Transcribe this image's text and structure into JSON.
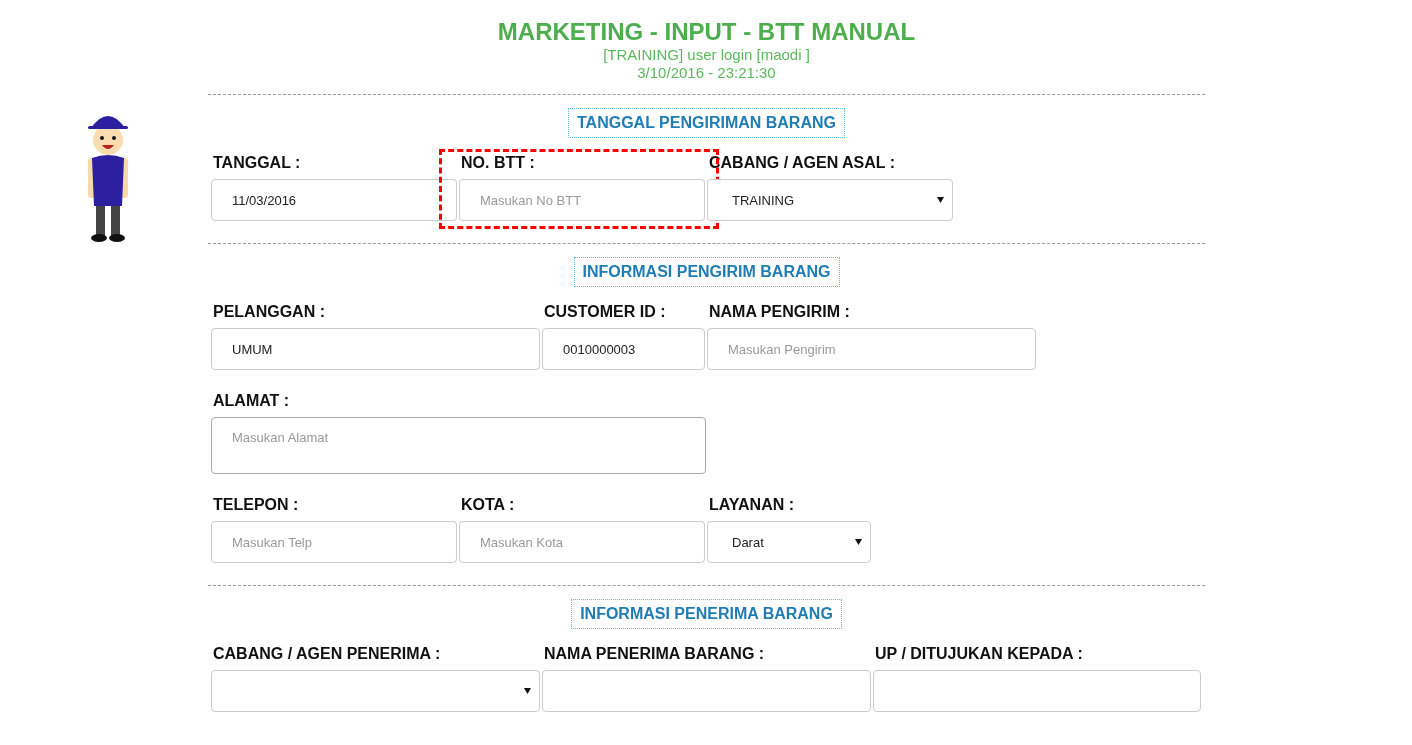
{
  "header": {
    "title": "MARKETING - INPUT - BTT MANUAL",
    "login": "[TRAINING] user login [maodi ]",
    "datetime": "3/10/2016 - 23:21:30"
  },
  "sections": [
    {
      "title": "TANGGAL PENGIRIMAN BARANG",
      "rows": [
        [
          {
            "label": "TANGGAL :",
            "kind": "input",
            "value": "11/03/2016",
            "highlighted": false
          },
          {
            "label": "NO. BTT :",
            "kind": "input",
            "placeholder": "Masukan No BTT",
            "highlighted": true
          },
          {
            "label": "CABANG / AGEN ASAL :",
            "kind": "select",
            "value": "TRAINING",
            "highlighted": false
          }
        ]
      ]
    },
    {
      "title": "INFORMASI PENGIRIM BARANG",
      "rows": [
        [
          {
            "label": "PELANGGAN :",
            "kind": "input",
            "value": "UMUM",
            "highlighted": false
          },
          {
            "label": "CUSTOMER ID :",
            "kind": "input",
            "value": "0010000003",
            "highlighted": false
          },
          {
            "label": "NAMA PENGIRIM :",
            "kind": "input",
            "placeholder": "Masukan Pengirim",
            "highlighted": false
          }
        ],
        [
          {
            "label": "ALAMAT :",
            "kind": "textarea",
            "placeholder": "Masukan Alamat",
            "highlighted": false
          }
        ],
        [
          {
            "label": "TELEPON :",
            "kind": "input",
            "placeholder": "Masukan Telp",
            "highlighted": false
          },
          {
            "label": "KOTA :",
            "kind": "input",
            "placeholder": "Masukan Kota",
            "highlighted": false
          },
          {
            "label": "LAYANAN :",
            "kind": "select",
            "value": "Darat",
            "highlighted": false
          }
        ]
      ]
    },
    {
      "title": "INFORMASI PENERIMA BARANG",
      "rows": [
        [
          {
            "label": "CABANG / AGEN PENERIMA :",
            "kind": "select",
            "highlighted": false
          },
          {
            "label": "NAMA PENERIMA BARANG :",
            "kind": "input",
            "highlighted": false
          },
          {
            "label": "UP / DITUJUKAN KEPADA :",
            "kind": "input",
            "highlighted": false
          }
        ]
      ]
    }
  ]
}
